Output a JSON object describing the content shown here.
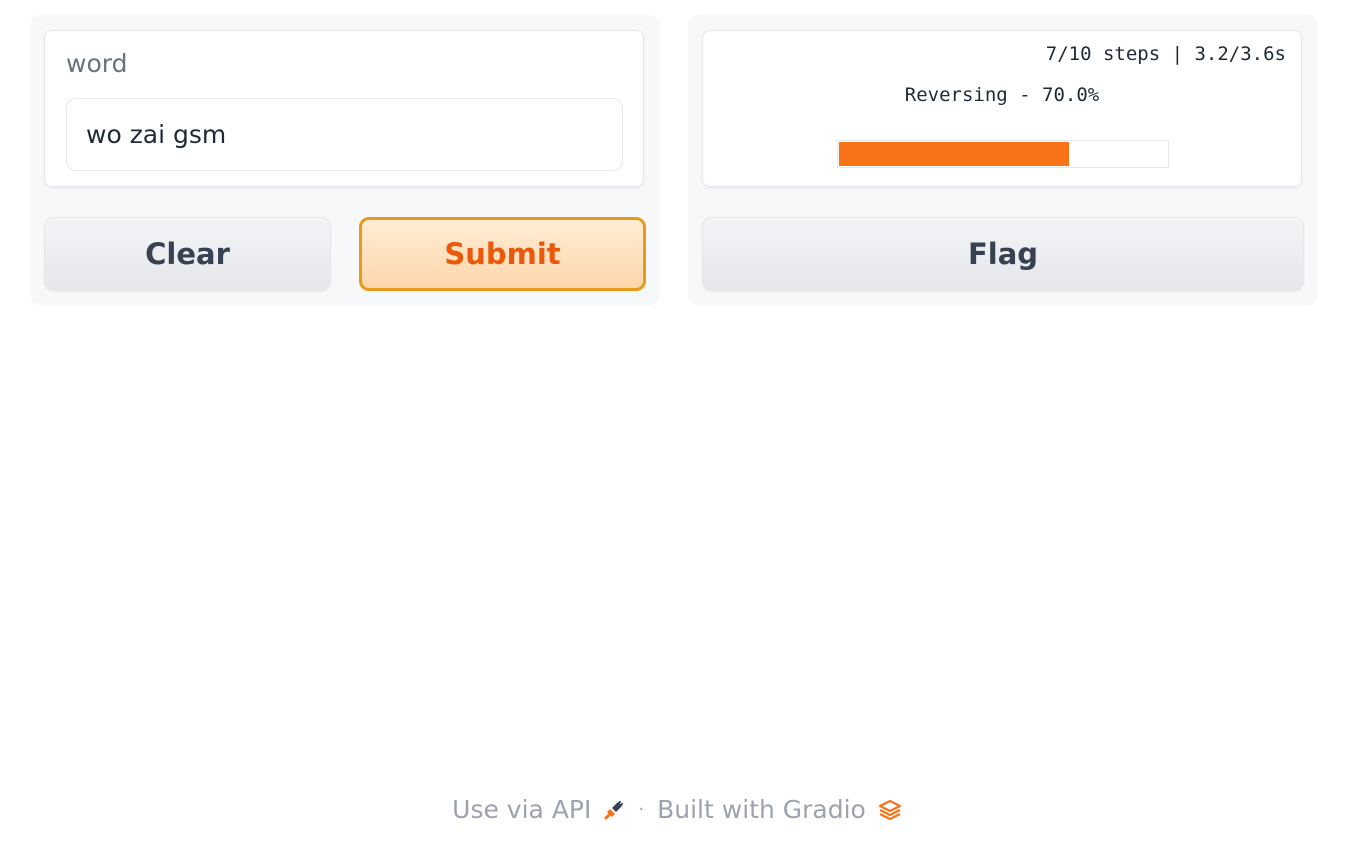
{
  "inputs": {
    "word": {
      "label": "word",
      "value": "wo zai gsm"
    },
    "clear_label": "Clear",
    "submit_label": "Submit"
  },
  "output": {
    "progress": {
      "steps": "7/10 steps | 3.2/3.6s",
      "status": "Reversing - 70.0%",
      "fraction": 0.7
    },
    "flag_label": "Flag"
  },
  "footer": {
    "api_label": "Use via API",
    "separator": "·",
    "built_label": "Built with Gradio"
  },
  "icons": {
    "api": "plug-icon",
    "gradio": "gradio-logo-icon"
  },
  "colors": {
    "accent": "#f97316",
    "submit_border": "#ea9a18",
    "submit_text": "#ea580c"
  }
}
